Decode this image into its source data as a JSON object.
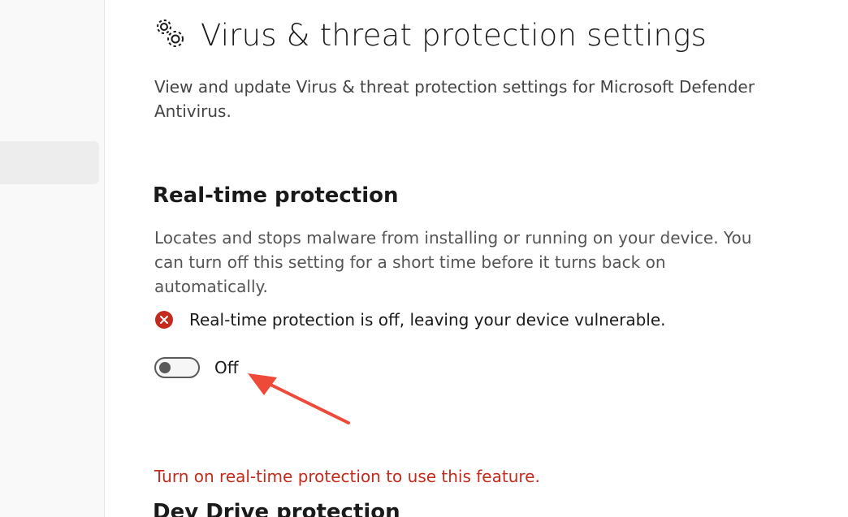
{
  "header": {
    "icon": "gears-icon",
    "title": "Virus & threat protection settings",
    "description": "View and update Virus & threat protection settings for Microsoft Defender Antivirus."
  },
  "realtime": {
    "title": "Real-time protection",
    "description": "Locates and stops malware from installing or running on your device. You can turn off this setting for a short time before it turns back on automatically.",
    "warning_icon": "error-circle-icon",
    "warning": "Real-time protection is off, leaving your device vulnerable.",
    "toggle_state": "Off",
    "toggle_on": false
  },
  "annotation": {
    "icon": "red-arrow-icon",
    "color": "#ee4a3a"
  },
  "dev_drive": {
    "error": "Turn on real-time protection to use this feature.",
    "title": "Dev Drive protection"
  },
  "colors": {
    "error": "#c42b1c",
    "arrow": "#ee4a3a"
  }
}
